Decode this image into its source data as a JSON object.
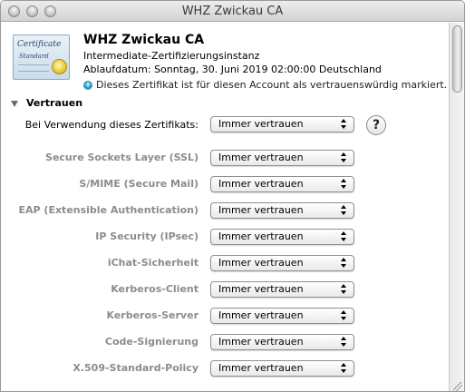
{
  "window": {
    "title": "WHZ Zwickau CA"
  },
  "certificate": {
    "icon_text": "Certificate",
    "icon_subtext": "Standard",
    "name": "WHZ Zwickau CA",
    "type": "Intermediate-Zertifizierungsinstanz",
    "expiry": "Ablaufdatum: Sonntag, 30. Juni 2019 02:00:00 Deutschland",
    "trust_note": "Dieses Zertifikat ist für diesen Account als vertrauenswürdig markiert.",
    "trust_icon": "plus-circle-icon",
    "trust_icon_color": "#2e9bc4"
  },
  "trust_section": {
    "label": "Vertrauen",
    "main_setting": {
      "label": "Bei Verwendung dieses Zertifikats:",
      "value": "Immer vertrauen"
    },
    "help_label": "?",
    "settings": [
      {
        "label": "Secure Sockets Layer (SSL)",
        "value": "Immer vertrauen"
      },
      {
        "label": "S/MIME (Secure Mail)",
        "value": "Immer vertrauen"
      },
      {
        "label": "EAP (Extensible Authentication)",
        "value": "Immer vertrauen"
      },
      {
        "label": "IP Security (IPsec)",
        "value": "Immer vertrauen"
      },
      {
        "label": "iChat-Sicherheit",
        "value": "Immer vertrauen"
      },
      {
        "label": "Kerberos-Client",
        "value": "Immer vertrauen"
      },
      {
        "label": "Kerberos-Server",
        "value": "Immer vertrauen"
      },
      {
        "label": "Code-Signierung",
        "value": "Immer vertrauen"
      },
      {
        "label": "X.509-Standard-Policy",
        "value": "Immer vertrauen"
      }
    ]
  }
}
